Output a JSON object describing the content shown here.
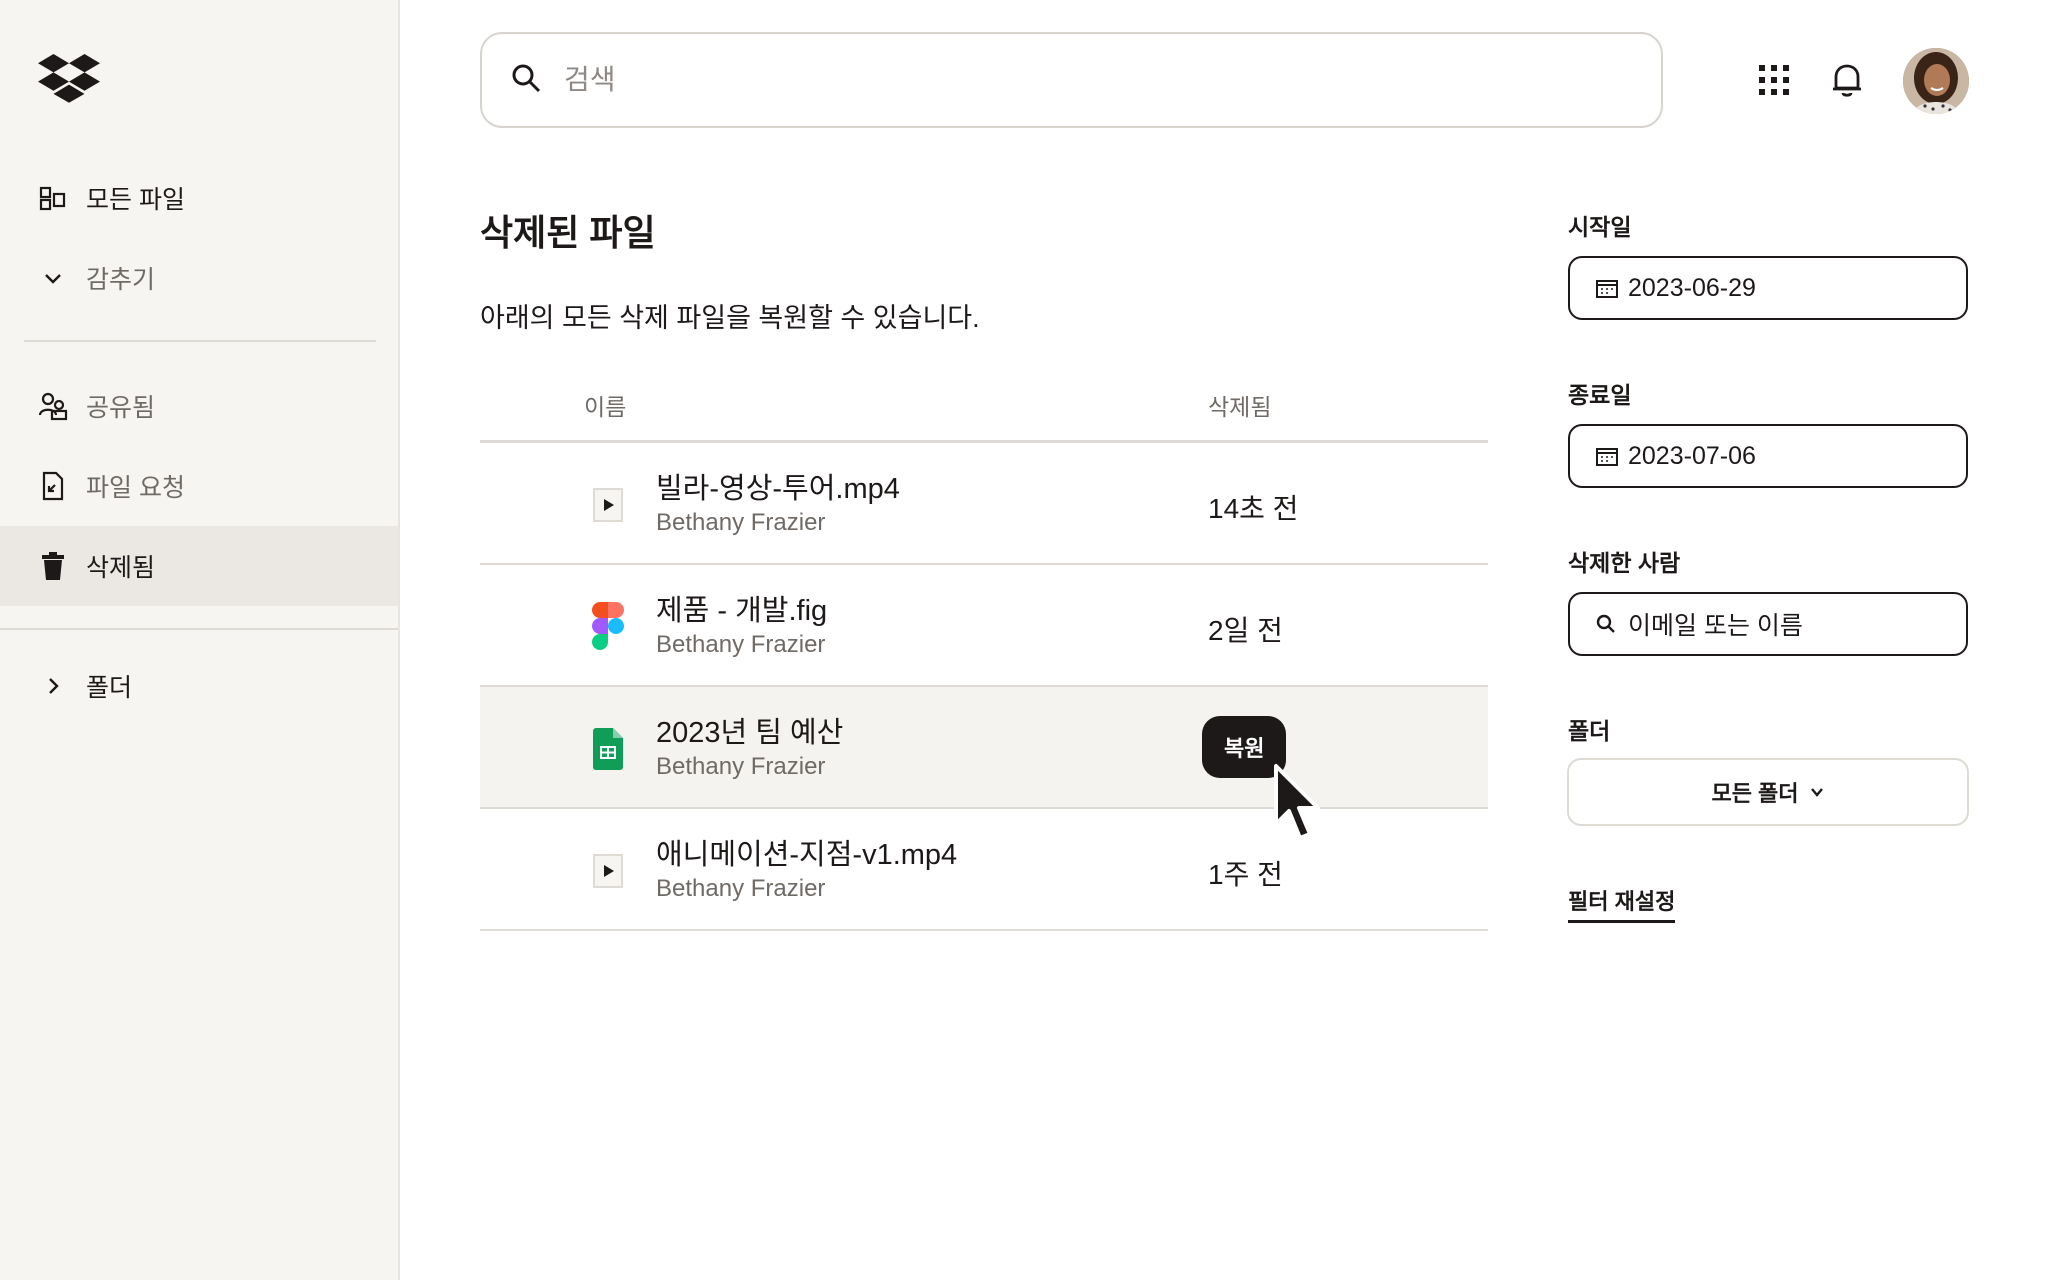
{
  "sidebar": {
    "logo_icon": "dropbox-logo",
    "items": [
      {
        "label": "모든 파일",
        "icon": "all-files-icon"
      },
      {
        "label": "감추기",
        "icon": "chevron-down-icon"
      },
      {
        "label": "공유됨",
        "icon": "shared-people-icon"
      },
      {
        "label": "파일 요청",
        "icon": "file-request-icon"
      },
      {
        "label": "삭제됨",
        "icon": "trash-icon"
      },
      {
        "label": "폴더",
        "icon": "chevron-right-icon"
      }
    ]
  },
  "header": {
    "search_placeholder": "검색",
    "apps_icon": "app-grid-icon",
    "notifications_icon": "bell-icon"
  },
  "main": {
    "title": "삭제된 파일",
    "description": "아래의 모든 삭제 파일을 복원할 수 있습니다.",
    "columns": {
      "name": "이름",
      "deleted": "삭제됨"
    },
    "rows": [
      {
        "name": "빌라-영상-투어.mp4",
        "owner": "Bethany Frazier",
        "deleted": "14초 전",
        "icon": "video-file-icon"
      },
      {
        "name": "제품 - 개발.fig",
        "owner": "Bethany Frazier",
        "deleted": "2일 전",
        "icon": "figma-file-icon"
      },
      {
        "name": "2023년 팀 예산",
        "owner": "Bethany Frazier",
        "deleted": "",
        "icon": "sheets-file-icon",
        "action_label": "복원"
      },
      {
        "name": "애니메이션-지점-v1.mp4",
        "owner": "Bethany Frazier",
        "deleted": "1주 전",
        "icon": "video-file-icon"
      }
    ]
  },
  "filters": {
    "start_date": {
      "label": "시작일",
      "value": "2023-06-29"
    },
    "end_date": {
      "label": "종료일",
      "value": "2023-07-06"
    },
    "deleted_by": {
      "label": "삭제한 사람",
      "placeholder": "이메일 또는 이름"
    },
    "folder": {
      "label": "폴더",
      "value": "모든 폴더"
    },
    "reset_label": "필터 재설정"
  },
  "colors": {
    "ink": "#1e1919",
    "sidebar_bg": "#f7f5f2",
    "active_bg": "#ebe8e4",
    "muted_text": "#6f6a66",
    "figma_red": "#f24e1e",
    "figma_purple": "#a259ff",
    "figma_blue": "#1abcfe",
    "figma_green": "#0acf83",
    "sheets_green": "#0f9d58"
  }
}
